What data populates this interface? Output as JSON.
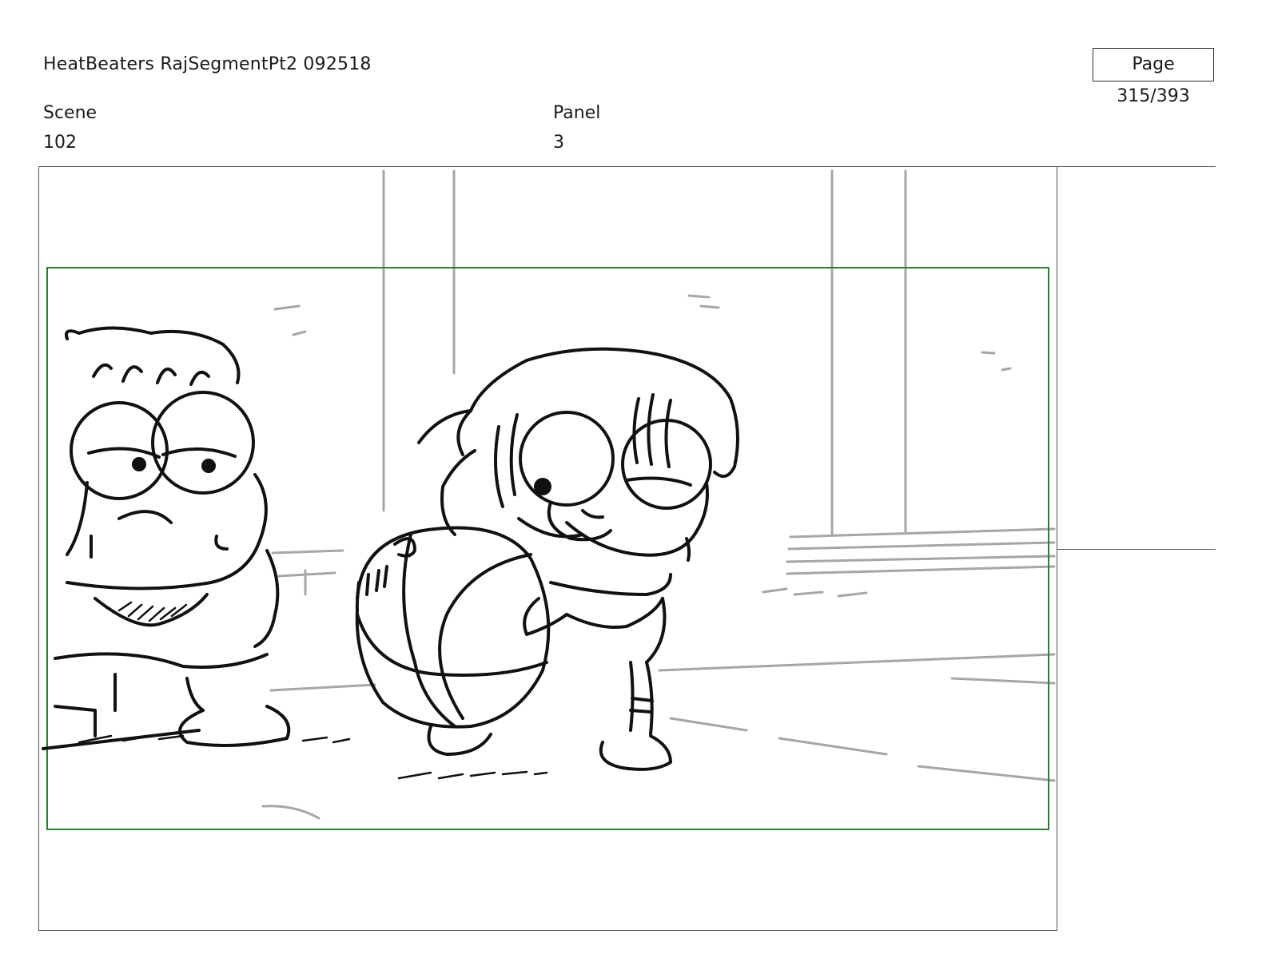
{
  "document": {
    "title": "HeatBeaters RajSegmentPt2 092518",
    "page_counter": "Page 315/393"
  },
  "fields": {
    "scene_label": "Scene",
    "scene_value": "102",
    "panel_label": "Panel",
    "panel_value": "3"
  },
  "drawing": {
    "safe_frame_color": "#2e7d32",
    "line_color": "#111111",
    "background_line_color": "#a6a6a6"
  }
}
